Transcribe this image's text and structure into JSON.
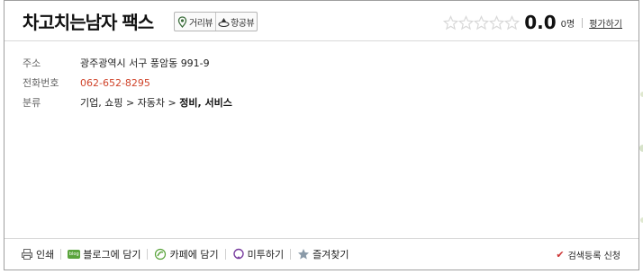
{
  "place": {
    "title": "차고치는남자 팩스",
    "view_buttons": [
      {
        "label": "거리뷰",
        "icon": "street-view-icon"
      },
      {
        "label": "항공뷰",
        "icon": "aerial-view-icon"
      }
    ]
  },
  "rating": {
    "stars_filled": 0,
    "stars_total": 5,
    "score": "0.0",
    "count": "0명",
    "review_link": "평가하기",
    "star_color": "#d8d8d8"
  },
  "info": {
    "address_label": "주소",
    "address": "광주광역시 서구 풍암동 991-9",
    "phone_label": "전화번호",
    "phone": "062-652-8295",
    "phone_color": "#d0442b",
    "category_label": "분류",
    "category_path": "기업, 쇼핑 > 자동차 >",
    "category_last": "정비, 서비스"
  },
  "footer": {
    "print": "인쇄",
    "blog_badge": "blog",
    "blog": "블로그에 담기",
    "cafe": "카페에 담기",
    "me2day": "미투하기",
    "favorite": "즐겨찾기",
    "register": "검색등록 신청"
  }
}
